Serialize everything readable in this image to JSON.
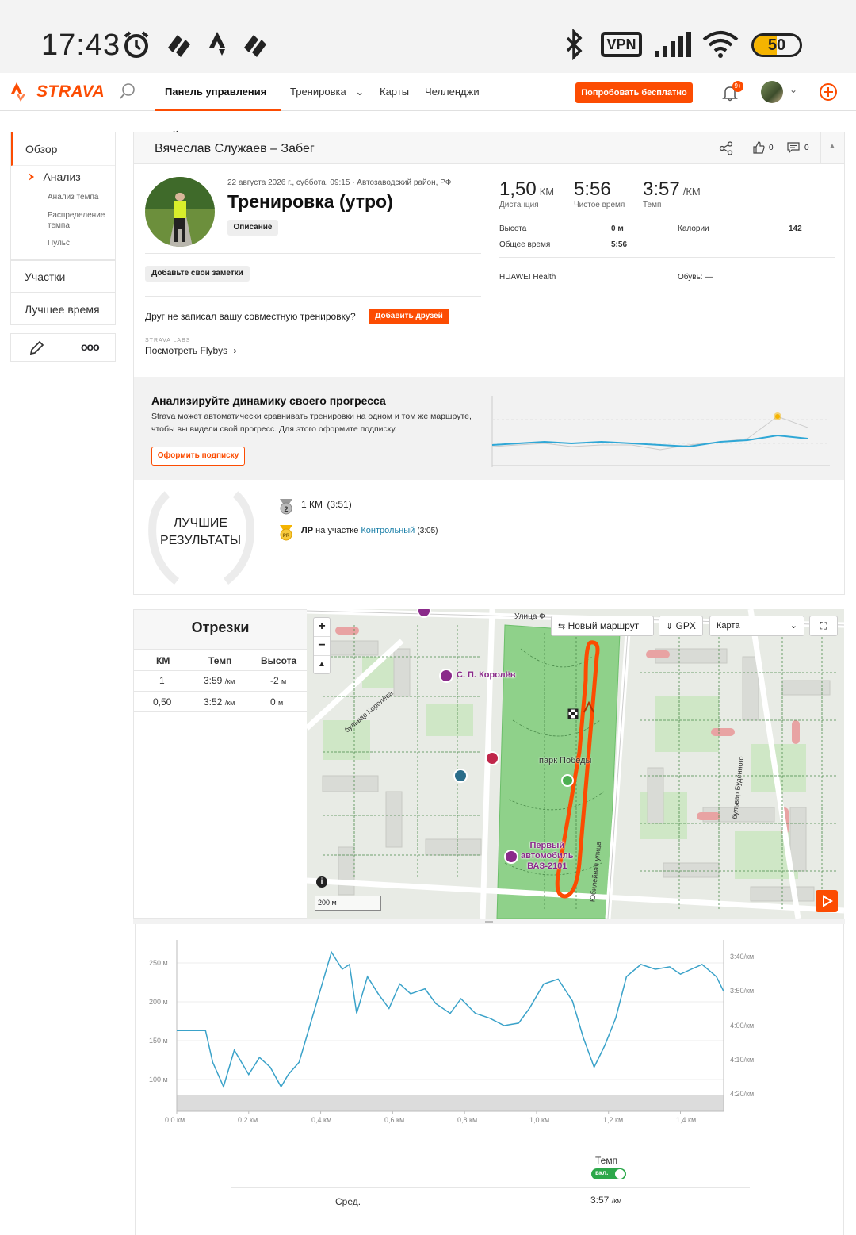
{
  "status_bar": {
    "time": "17:43",
    "vpn_label": "VPN",
    "battery_level": "50",
    "icons": [
      "alarm-icon",
      "strava-notification-icon",
      "strava-notification-icon",
      "strava-notification-icon",
      "bluetooth-icon",
      "signal-icon",
      "wifi-icon"
    ]
  },
  "topnav": {
    "logo": "STRAVA",
    "items": [
      "Панель управления",
      "Тренировка",
      "Карты",
      "Челленджи"
    ],
    "try_button": "Попробовать бесплатно",
    "notification_badge": "9+"
  },
  "sidebar": {
    "overview": "Обзор",
    "analysis": "Анализ",
    "analysis_subitems": [
      "Анализ темпа",
      "Распределение темпа",
      "Пульс"
    ],
    "segments": "Участки",
    "best_time": "Лучшее время"
  },
  "activity": {
    "header_title": "Вячеслав Служаев – Забег",
    "kudos_count": "0",
    "comments_count": "0",
    "date_line": "22 августа 2026 г., суббота, 09:15 · Автозаводский район, РФ",
    "title": "Тренировка (утро)",
    "description_btn": "Описание",
    "notes_btn": "Добавьте свои заметки",
    "friend_prompt": "Друг не записал вашу совместную тренировку?",
    "add_friends_btn": "Добавить друзей",
    "labs_label": "STRAVA LABS",
    "flybys_link": "Посмотреть Flybys"
  },
  "stats": {
    "distance_value": "1,50",
    "distance_unit": "КМ",
    "distance_label": "Дистанция",
    "moving_time_value": "5:56",
    "moving_time_label": "Чистое время",
    "pace_value": "3:57",
    "pace_unit": "/КМ",
    "pace_label": "Темп",
    "elevation_label": "Высота",
    "elevation_value": "0 м",
    "elapsed_label": "Общее время",
    "elapsed_value": "5:56",
    "calories_label": "Калории",
    "calories_value": "142",
    "device": "HUAWEI Health",
    "shoes": "Обувь: —"
  },
  "promo": {
    "title": "Анализируйте динамику своего прогресса",
    "text": "Strava может автоматически сравнивать тренировки на одном и том же маршруте, чтобы вы видели свой прогресс. Для этого оформите подписку.",
    "button": "Оформить подписку"
  },
  "best_results": {
    "title_line1": "ЛУЧШИЕ",
    "title_line2": "РЕЗУЛЬТАТЫ",
    "item1_name": "1 КМ",
    "item1_time": "(3:51)",
    "item1_rank": "2",
    "item2_pr": "ЛР",
    "item2_text": "на участке",
    "item2_link": "Контрольный",
    "item2_time": "(3:05)",
    "item2_badge": "PR"
  },
  "splits": {
    "title": "Отрезки",
    "headers": [
      "КМ",
      "Темп",
      "Высота"
    ],
    "rows": [
      {
        "km": "1",
        "pace": "3:59",
        "pace_unit": "/км",
        "elev": "-2",
        "elev_unit": "м"
      },
      {
        "km": "0,50",
        "pace": "3:52",
        "pace_unit": "/км",
        "elev": "0",
        "elev_unit": "м"
      }
    ]
  },
  "map": {
    "new_route": "Новый маршрут",
    "gpx": "GPX",
    "layer": "Карта",
    "scale": "200 м",
    "labels": {
      "park": "парк Победы",
      "street1": "бульвар Королёва",
      "street2": "Юбилейная улица",
      "street3": "бульвар Будённого",
      "street4": "Улица Ф",
      "poi1": "С. П. Королёв",
      "poi2_l1": "Первый",
      "poi2_l2": "автомобиль",
      "poi2_l3": "ВАЗ-2101"
    }
  },
  "elevation_chart": {
    "y_left": [
      "250 м",
      "200 м",
      "150 м",
      "100 м"
    ],
    "y_right": [
      "3:40/км",
      "3:50/км",
      "4:00/км",
      "4:10/км",
      "4:20/км"
    ],
    "x": [
      "0,0 км",
      "0,2 км",
      "0,4 км",
      "0,6 км",
      "0,8 км",
      "1,0 км",
      "1,2 км",
      "1,4 км"
    ],
    "pace_toggle_label": "Темп",
    "pace_toggle_state": "вкл.",
    "avg_label": "Сред.",
    "avg_value": "3:57",
    "avg_unit": "/км"
  },
  "chart_data": {
    "type": "line",
    "xlabel": "",
    "ylabel": "",
    "series": [
      {
        "x": [
          0.0,
          0.08,
          0.1,
          0.13,
          0.16,
          0.2,
          0.23,
          0.26,
          0.29,
          0.31,
          0.34,
          0.37,
          0.4,
          0.43,
          0.46,
          0.48,
          0.5,
          0.53,
          0.56,
          0.59,
          0.62,
          0.65,
          0.69,
          0.72,
          0.76,
          0.79,
          0.83,
          0.87,
          0.91,
          0.95,
          0.98,
          1.02,
          1.06,
          1.1,
          1.13,
          1.16,
          1.19,
          1.22,
          1.25,
          1.29,
          1.33,
          1.37,
          1.4,
          1.43,
          1.46,
          1.5,
          1.52
        ],
        "y": [
          3.97,
          3.97,
          4.1,
          4.2,
          4.05,
          4.15,
          4.08,
          4.12,
          4.2,
          4.15,
          4.1,
          3.95,
          3.8,
          3.65,
          3.72,
          3.7,
          3.9,
          3.75,
          3.82,
          3.88,
          3.78,
          3.82,
          3.8,
          3.86,
          3.9,
          3.84,
          3.9,
          3.92,
          3.95,
          3.94,
          3.88,
          3.78,
          3.76,
          3.85,
          4.0,
          4.12,
          4.03,
          3.92,
          3.75,
          3.7,
          3.72,
          3.71,
          3.74,
          3.72,
          3.7,
          3.75,
          3.81
        ]
      }
    ],
    "x_range": [
      0,
      1.52
    ],
    "y_range_pace_min_per_km": [
      3.6,
      4.3
    ],
    "elevation_ylim_m": [
      80,
      260
    ],
    "grid": true
  }
}
